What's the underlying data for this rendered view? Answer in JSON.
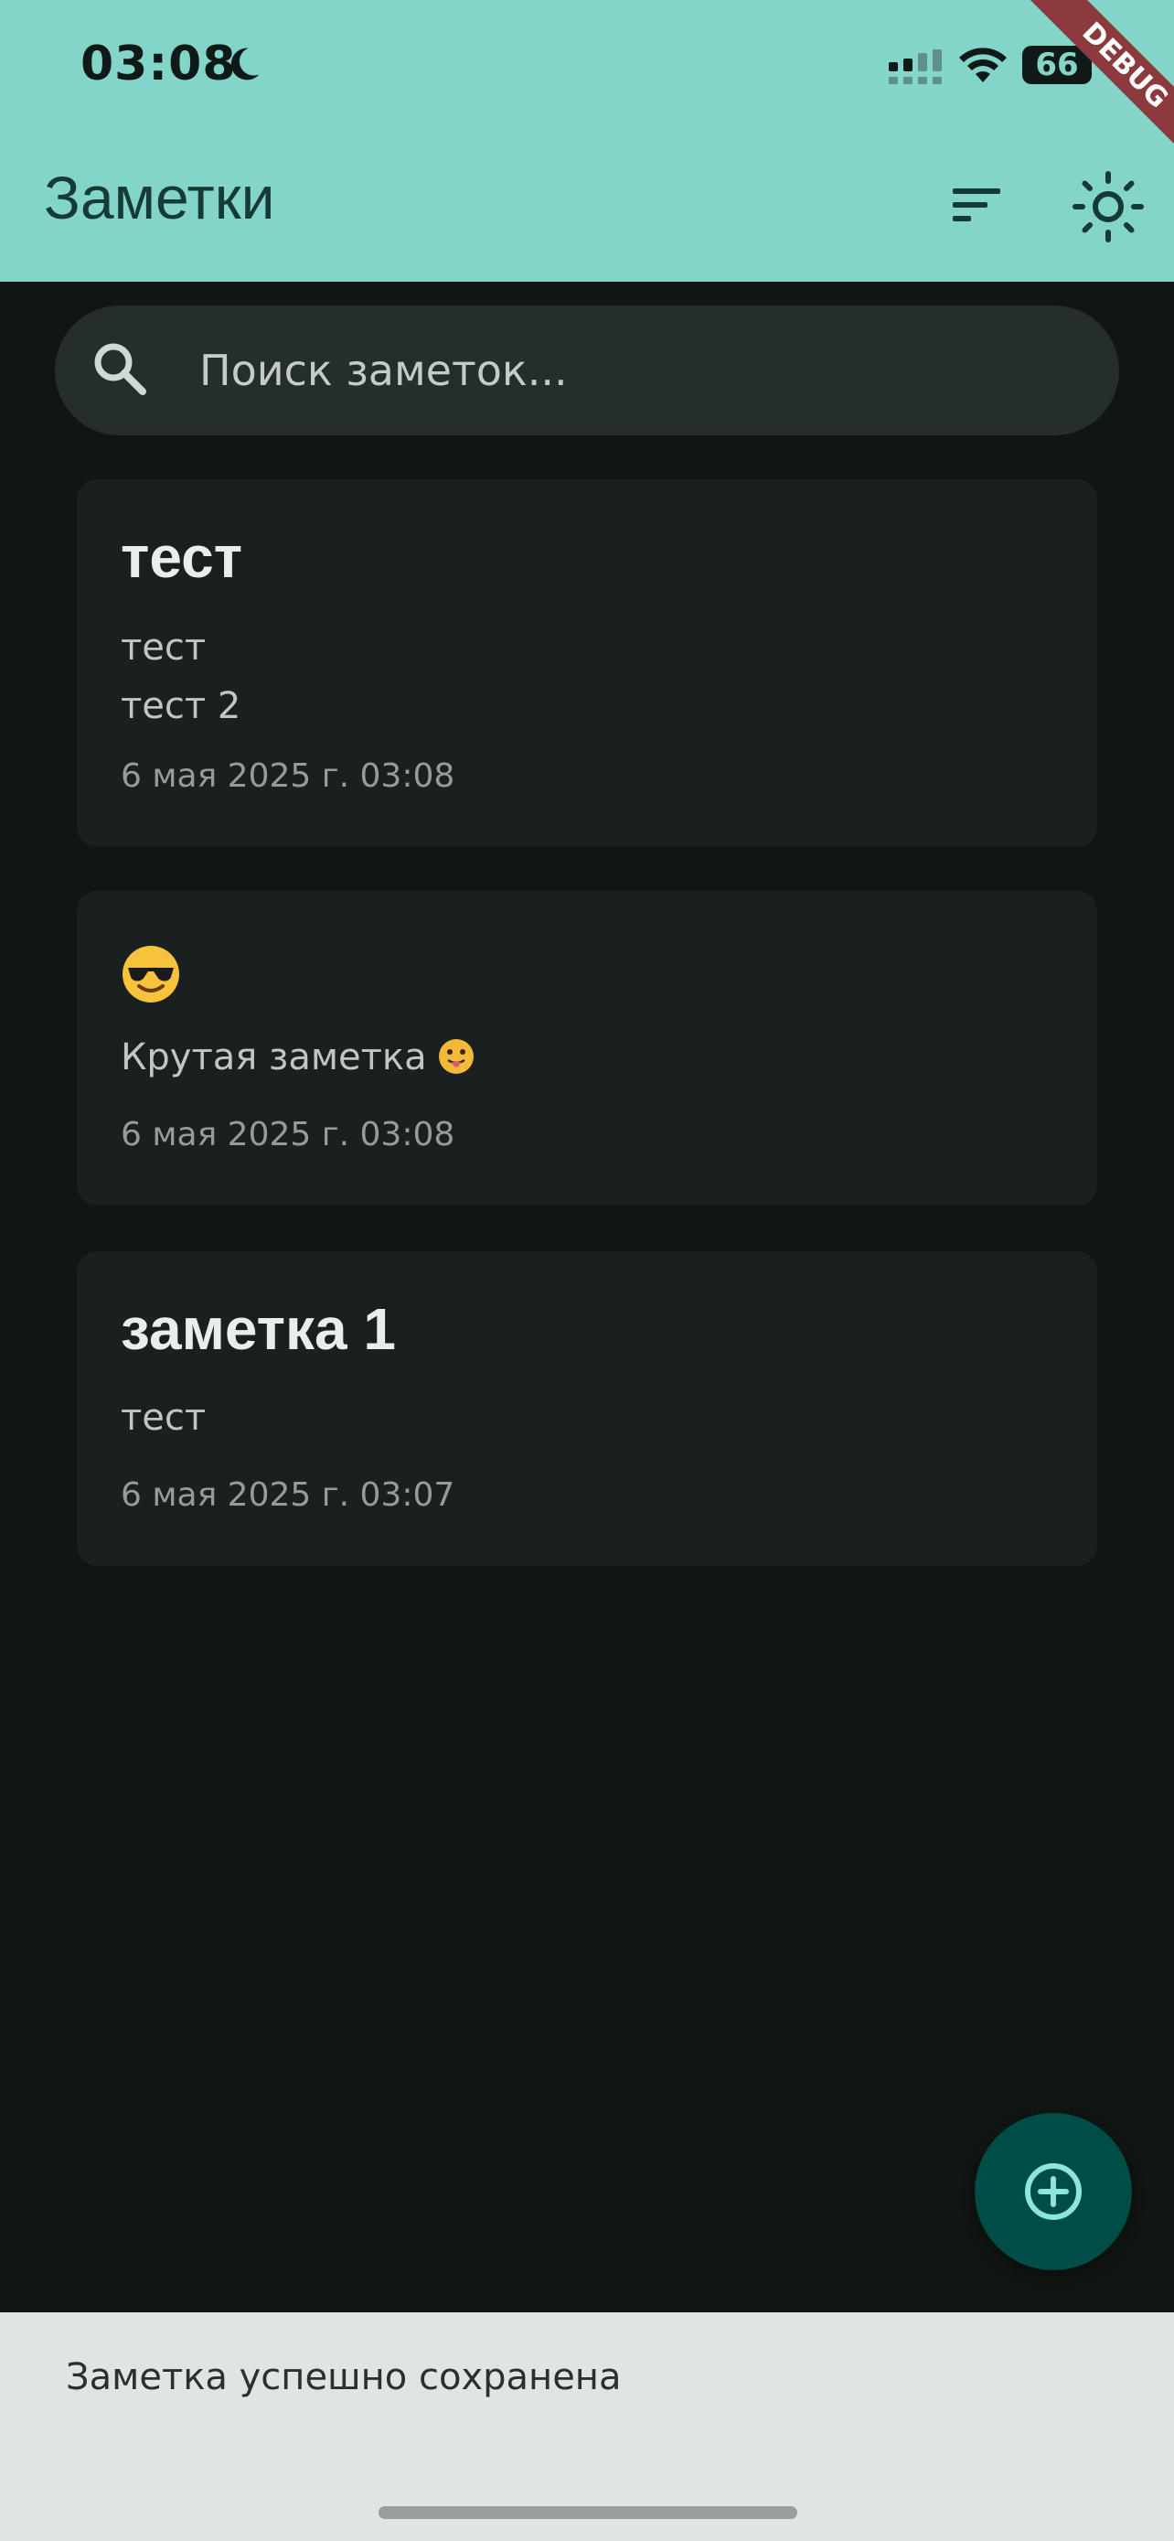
{
  "status_bar": {
    "time": "03:08",
    "battery": "66",
    "icons": [
      "moon-icon",
      "cellular-signal-icon",
      "wifi-icon",
      "battery-icon"
    ]
  },
  "debug_banner": "DEBUG",
  "app_bar": {
    "title": "Заметки",
    "actions": [
      "sort-icon",
      "sun-icon"
    ]
  },
  "search": {
    "placeholder": "Поиск заметок..."
  },
  "notes": [
    {
      "title": "тест",
      "lines": [
        "тест",
        "тест 2"
      ],
      "date": "6 мая 2025 г. 03:08"
    },
    {
      "title": "😎",
      "title_icon": "smiling-face-with-sunglasses-emoji",
      "text": "Крутая заметка",
      "text_emoji": "face-with-tongue-emoji",
      "date": "6 мая 2025 г. 03:08"
    },
    {
      "title": "заметка 1",
      "lines": [
        "тест"
      ],
      "date": "6 мая 2025 г. 03:07"
    }
  ],
  "fab": {
    "icon": "add-circle-icon"
  },
  "snackbar": {
    "message": "Заметка успешно сохранена"
  },
  "colors": {
    "app_bar": "#84d5c9",
    "background": "#101614",
    "card": "#1a1f1f",
    "fab": "#004d47",
    "snackbar": "#e0e5e4",
    "debug_ribbon": "#8b3a3e"
  }
}
